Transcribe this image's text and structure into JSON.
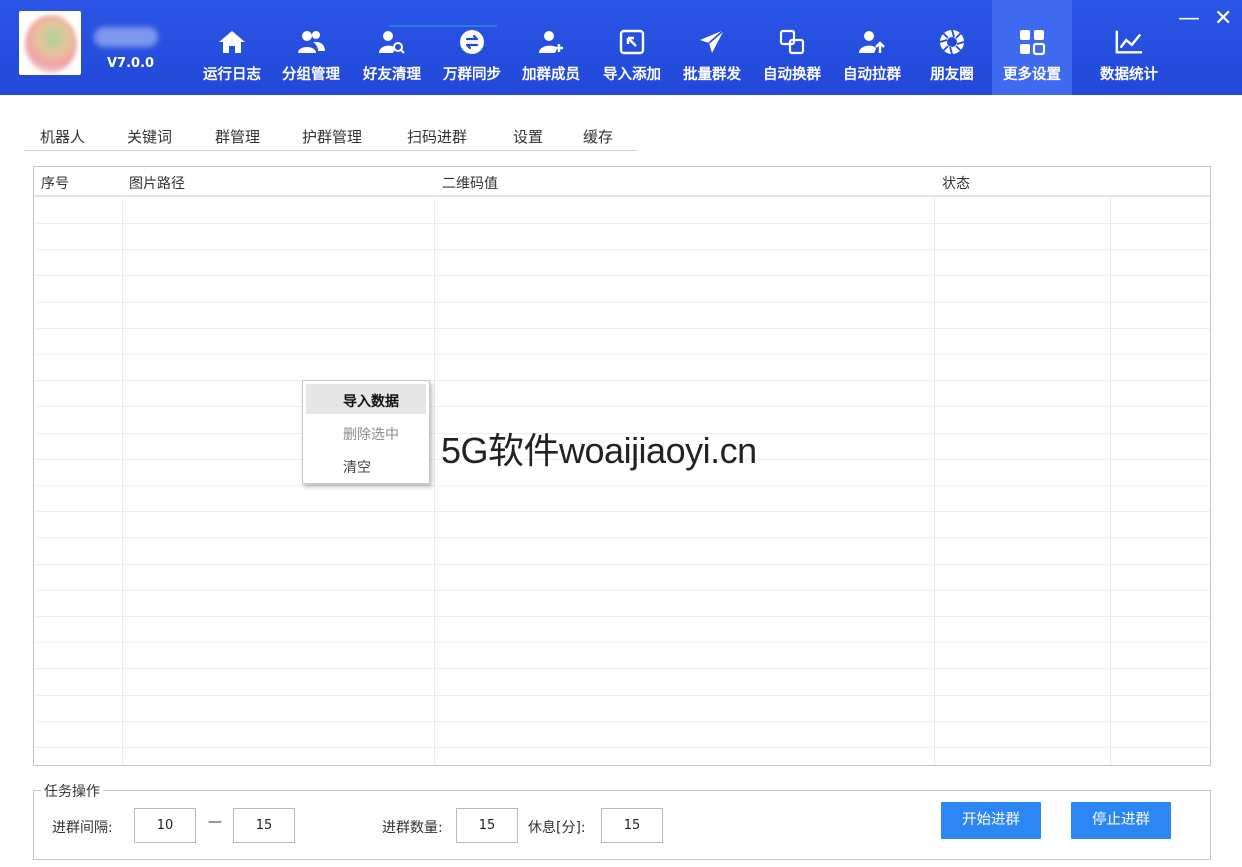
{
  "app": {
    "version": "V7.0.0"
  },
  "nav": [
    {
      "key": "log",
      "label": "运行日志",
      "icon": "home-icon"
    },
    {
      "key": "group",
      "label": "分组管理",
      "icon": "users-icon"
    },
    {
      "key": "friends",
      "label": "好友清理",
      "icon": "user-search-icon"
    },
    {
      "key": "sync",
      "label": "万群同步",
      "icon": "sync-icon"
    },
    {
      "key": "addmember",
      "label": "加群成员",
      "icon": "user-add-icon"
    },
    {
      "key": "import",
      "label": "导入添加",
      "icon": "import-icon"
    },
    {
      "key": "broadcast",
      "label": "批量群发",
      "icon": "send-icon"
    },
    {
      "key": "switch",
      "label": "自动换群",
      "icon": "switch-icon"
    },
    {
      "key": "pull",
      "label": "自动拉群",
      "icon": "user-up-icon"
    },
    {
      "key": "moments",
      "label": "朋友圈",
      "icon": "aperture-icon"
    },
    {
      "key": "more",
      "label": "更多设置",
      "icon": "grid-icon"
    },
    {
      "key": "stats",
      "label": "数据统计",
      "icon": "chart-icon"
    }
  ],
  "window": {
    "minimize": "—",
    "close": "✕"
  },
  "tabs": [
    "机器人",
    "关键词",
    "群管理",
    "护群管理",
    "扫码进群",
    "设置",
    "缓存"
  ],
  "active_tab": "扫码进群",
  "table": {
    "columns": [
      "序号",
      "图片路径",
      "二维码值",
      "状态"
    ]
  },
  "context_menu": [
    "导入数据",
    "删除选中",
    "清空"
  ],
  "watermark": "5G软件woaijiaoyi.cn",
  "task": {
    "title": "任务操作",
    "interval_label": "进群间隔:",
    "interval_min": "10",
    "dash": "—",
    "interval_max": "15",
    "count_label": "进群数量:",
    "count": "15",
    "rest_label": "休息[分]:",
    "rest": "15",
    "start": "开始进群",
    "stop": "停止进群"
  },
  "colors": {
    "header": "#2248d8",
    "active_nav": "#3f6af0",
    "button": "#2c86f4",
    "tab_underline": "#2a7de1"
  }
}
